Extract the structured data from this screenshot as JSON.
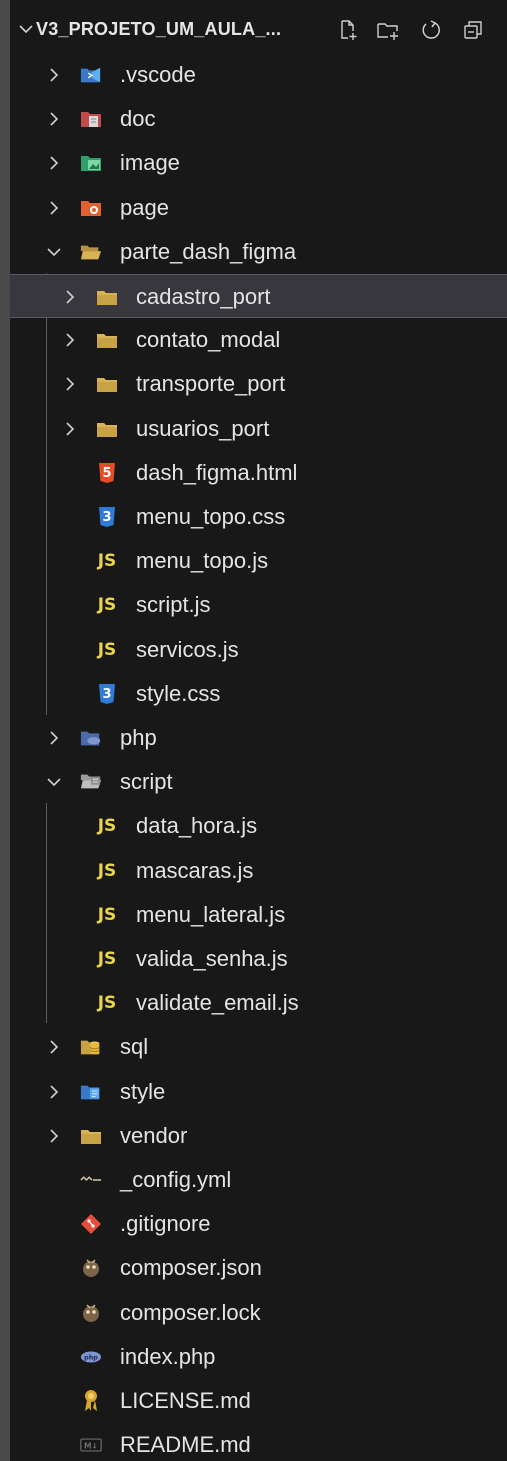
{
  "explorer": {
    "title": "V3_PROJETO_UM_AULA_...",
    "toolbar": [
      "new-file",
      "new-folder",
      "refresh",
      "collapse-all"
    ]
  },
  "colors": {
    "background": "#181818",
    "selected": "#37373d",
    "folder": "#d8b255",
    "js": "#e8d44d",
    "html": "#e44d26",
    "css": "#2f7bd6"
  },
  "tree": [
    {
      "label": ".vscode",
      "type": "folder",
      "icon": "vscode-folder-icon"
    },
    {
      "label": "doc",
      "type": "folder",
      "icon": "doc-folder-icon"
    },
    {
      "label": "image",
      "type": "folder",
      "icon": "image-folder-icon"
    },
    {
      "label": "page",
      "type": "folder",
      "icon": "page-folder-icon"
    },
    {
      "label": "parte_dash_figma",
      "type": "folder-open",
      "icon": "folder-open-icon"
    },
    {
      "label": "cadastro_port",
      "type": "folder",
      "icon": "folder-icon",
      "selected": true
    },
    {
      "label": "contato_modal",
      "type": "folder",
      "icon": "folder-icon"
    },
    {
      "label": "transporte_port",
      "type": "folder",
      "icon": "folder-icon"
    },
    {
      "label": "usuarios_port",
      "type": "folder",
      "icon": "folder-icon"
    },
    {
      "label": "dash_figma.html",
      "type": "file",
      "icon": "html5-icon"
    },
    {
      "label": "menu_topo.css",
      "type": "file",
      "icon": "css3-icon"
    },
    {
      "label": "menu_topo.js",
      "type": "file",
      "icon": "js-icon"
    },
    {
      "label": "script.js",
      "type": "file",
      "icon": "js-icon"
    },
    {
      "label": "servicos.js",
      "type": "file",
      "icon": "js-icon"
    },
    {
      "label": "style.css",
      "type": "file",
      "icon": "css3-icon"
    },
    {
      "label": "php",
      "type": "folder",
      "icon": "php-folder-icon"
    },
    {
      "label": "script",
      "type": "folder-open",
      "icon": "script-folder-open-icon"
    },
    {
      "label": "data_hora.js",
      "type": "file",
      "icon": "js-icon"
    },
    {
      "label": "mascaras.js",
      "type": "file",
      "icon": "js-icon"
    },
    {
      "label": "menu_lateral.js",
      "type": "file",
      "icon": "js-icon"
    },
    {
      "label": "valida_senha.js",
      "type": "file",
      "icon": "js-icon"
    },
    {
      "label": "validate_email.js",
      "type": "file",
      "icon": "js-icon"
    },
    {
      "label": "sql",
      "type": "folder",
      "icon": "sql-folder-icon"
    },
    {
      "label": "style",
      "type": "folder",
      "icon": "style-folder-icon"
    },
    {
      "label": "vendor",
      "type": "folder",
      "icon": "folder-icon"
    },
    {
      "label": "_config.yml",
      "type": "file",
      "icon": "yaml-icon"
    },
    {
      "label": ".gitignore",
      "type": "file",
      "icon": "git-icon"
    },
    {
      "label": "composer.json",
      "type": "file",
      "icon": "composer-icon"
    },
    {
      "label": "composer.lock",
      "type": "file",
      "icon": "composer-icon"
    },
    {
      "label": "index.php",
      "type": "file",
      "icon": "php-file-icon"
    },
    {
      "label": "LICENSE.md",
      "type": "file",
      "icon": "license-icon"
    },
    {
      "label": "README.md",
      "type": "file",
      "icon": "markdown-icon"
    }
  ]
}
